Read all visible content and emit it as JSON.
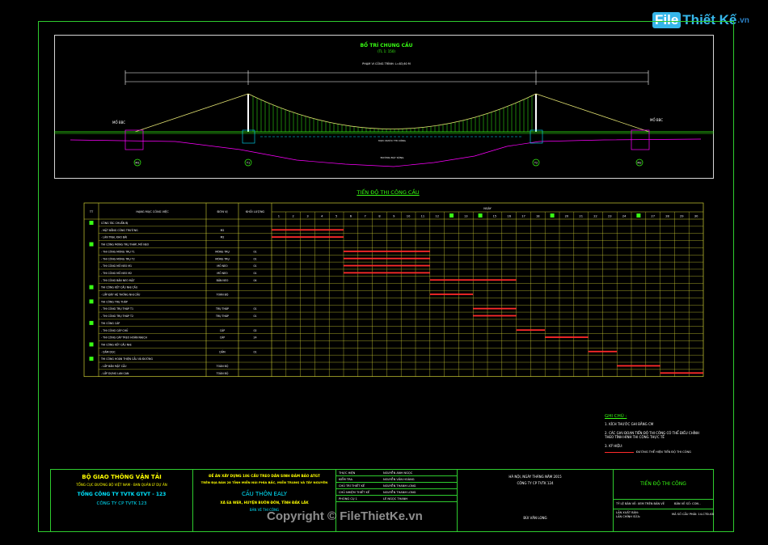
{
  "watermark": {
    "brand": "File",
    "brand2": "Thiết Kế",
    "suffix": ".vn",
    "copyright": "Copyright © FileThietKe.vn"
  },
  "drawing": {
    "title": "BỐ TRÍ CHUNG CẦU",
    "scale": "(TL 1: 150)",
    "length_note": "PHẠM VI CÔNG TRÌNH: L=83,60 M",
    "labels": {
      "mo_left": "MỐ BBC",
      "mo_right": "MỐ BBC",
      "water": "MỰC NƯỚC THI CÔNG",
      "bed": "ĐƯỜNG ĐÁY SÔNG"
    },
    "supports": [
      "M1",
      "T1",
      "T2",
      "M2"
    ]
  },
  "schedule": {
    "title": "TIẾN ĐỘ THI CÔNG CẦU",
    "headers": {
      "tt": "TT",
      "work": "HẠNG MỤC CÔNG VIỆC",
      "unit": "ĐƠN VỊ",
      "qty": "KHỐI LƯỢNG",
      "days": "NGÀY"
    },
    "day_labels": [
      "1",
      "2",
      "3",
      "4",
      "5",
      "6",
      "7",
      "8",
      "9",
      "10",
      "11",
      "12",
      "",
      "13",
      "",
      "15",
      "16",
      "17",
      "18",
      "",
      "20",
      "21",
      "22",
      "23",
      "24",
      "",
      "27",
      "28",
      "29",
      "30"
    ],
    "rows": [
      {
        "group": true,
        "name": "CÔNG TÁC CHUẨN BỊ",
        "unit": "",
        "qty": "",
        "bar": null
      },
      {
        "group": false,
        "name": "- MẶT BẰNG CÔNG TRƯỜNG",
        "unit": "M2",
        "qty": "",
        "bar": [
          1,
          5
        ]
      },
      {
        "group": false,
        "name": "- LÁN TRẠI, KHO BÃI",
        "unit": "M2",
        "qty": "",
        "bar": [
          1,
          5
        ]
      },
      {
        "group": true,
        "name": "THI CÔNG MÓNG TRỤ THÁP, MỐ NEO",
        "unit": "",
        "qty": "",
        "bar": null
      },
      {
        "group": false,
        "name": "- THI CÔNG MÓNG TRỤ T1",
        "unit": "MÓNG TRỤ",
        "qty": "01",
        "bar": [
          6,
          11
        ]
      },
      {
        "group": false,
        "name": "- THI CÔNG MÓNG TRỤ T2",
        "unit": "MÓNG TRỤ",
        "qty": "01",
        "bar": [
          6,
          11
        ]
      },
      {
        "group": false,
        "name": "- THI CÔNG MỐ NEO M1",
        "unit": "MỐ NEO",
        "qty": "01",
        "bar": [
          6,
          11
        ]
      },
      {
        "group": false,
        "name": "- THI CÔNG MỐ NEO M2",
        "unit": "MỐ NEO",
        "qty": "01",
        "bar": [
          6,
          11
        ]
      },
      {
        "group": false,
        "name": "- THI CÔNG BẢN NEO MẶT",
        "unit": "BẢN NEO",
        "qty": "04",
        "bar": [
          12,
          17
        ]
      },
      {
        "group": true,
        "name": "THI CÔNG KẾT CẤU NHỊ CẦU",
        "unit": "",
        "qty": "",
        "bar": null
      },
      {
        "group": false,
        "name": "- LẮP ĐẶT HỆ THỐNG NHỊ CẦU",
        "unit": "TOÀN BỘ",
        "qty": "",
        "bar": [
          12,
          14
        ]
      },
      {
        "group": true,
        "name": "THI CÔNG TRỤ THÁP",
        "unit": "",
        "qty": "",
        "bar": null
      },
      {
        "group": false,
        "name": "- THI CÔNG TRỤ THÁP T1",
        "unit": "TRỤ THÁP",
        "qty": "01",
        "bar": [
          15,
          17
        ]
      },
      {
        "group": false,
        "name": "- THI CÔNG TRỤ THÁP T2",
        "unit": "TRỤ THÁP",
        "qty": "01",
        "bar": [
          15,
          17
        ]
      },
      {
        "group": true,
        "name": "THI CÔNG CÁP",
        "unit": "",
        "qty": "",
        "bar": null
      },
      {
        "group": false,
        "name": "- THI CÔNG CÁP CHỦ",
        "unit": "CÁP",
        "qty": "02",
        "bar": [
          18,
          19
        ]
      },
      {
        "group": false,
        "name": "- THI CÔNG CÁP TREO HOÀN NHỊCH",
        "unit": "CÁP",
        "qty": "24",
        "bar": [
          20,
          22
        ]
      },
      {
        "group": true,
        "name": "THI CÔNG KẾT CẤU NHỊ",
        "unit": "",
        "qty": "",
        "bar": null
      },
      {
        "group": false,
        "name": "- DẦM DỌC",
        "unit": "DẦM",
        "qty": "01",
        "bar": [
          23,
          24
        ]
      },
      {
        "group": true,
        "name": "THI CÔNG HOÀN THIỆN CẦU VÀ ĐƯỜNG",
        "unit": "",
        "qty": "",
        "bar": null
      },
      {
        "group": false,
        "name": "- LẮP BẢN MẶT CẦU",
        "unit": "TOÀN BỘ",
        "qty": "",
        "bar": [
          25,
          27
        ]
      },
      {
        "group": false,
        "name": "- LẮP DỰNG LAN CAN",
        "unit": "TOÀN BỘ",
        "qty": "",
        "bar": [
          28,
          30
        ]
      }
    ]
  },
  "notes": {
    "title": "GHI CHÚ :",
    "items": [
      "1. KÍCH THƯỚC GHI BẰNG CM",
      "2. CÁC GIAI ĐOẠN TIẾN ĐỘ THI CÔNG CÓ THỂ ĐIỀU CHỈNH",
      "   THEO TÌNH HÌNH THI CÔNG THỰC TẾ",
      "3. KÝ HIỆU:"
    ],
    "legend": "ĐƯỜNG THỂ HIỆN TIẾN ĐỘ THI CÔNG"
  },
  "title_block": {
    "ministry": "BỘ GIAO THÔNG VẬN TẢI",
    "dept": "TỔNG CỤC ĐƯỜNG BỘ VIỆT NAM - BAN QUẢN LÝ DỰ ÁN",
    "corp": "TỔNG CÔNG TY TVTK GTVT - 123",
    "company": "CÔNG TY CP TVTK 123",
    "project_1": "ĐỀ ÁN XÂY DỰNG 186 CẦU TREO DÂN SINH ĐẢM BẢO ATGT",
    "project_2": "TRÊN ĐỊA BÀN 28 TỈNH MIỀN NÚI PHÍA BẮC, MIỀN TRUNG VÀ TÂY NGUYÊN",
    "bridge_name": "CẦU THÔN EALY",
    "location": "XÃ EA WER, HUYỆN BUÔN ĐÔN, TỈNH ĐẮK LẮK",
    "stage": "BẢN VẼ THI CÔNG",
    "roles": [
      {
        "role": "THỰC HIỆN",
        "name": "NGUYỄN ANH NGỌC"
      },
      {
        "role": "KIỂM TRA",
        "name": "NGUYỄN VĂN HOÀNG"
      },
      {
        "role": "CHỦ TRÌ THIẾT KẾ",
        "name": "NGUYỄN THANH LONG"
      },
      {
        "role": "CHỦ NHIỆM THIẾT KẾ",
        "name": "NGUYỄN THANH LONG"
      },
      {
        "role": "PHÒNG CỤ 1",
        "name": "LÊ NGỌC THANH"
      }
    ],
    "date": "HÀ NỘI, NGÀY      THÁNG     NĂM 2015",
    "sign_company": "CÔNG TY CP TVTK 124",
    "signer": "BÙI VĂN LONG",
    "sheet_title": "TIẾN ĐỘ THI CÔNG",
    "meta_1": "TỶ LỆ BẢN VẼ: XEM TRÊN BẢN VẼ",
    "meta_2": "BẢN VẼ SỐ: CON -",
    "meta_3": "LẦN XUẤT BẢN:",
    "meta_4": "LẦN CHỈNH SỬA:",
    "meta_5": "MÃ SỐ CẦU PHẢI: 14-CTĐ-KB"
  },
  "colors": {
    "frame": "#2ecc2e",
    "bar": "#ff2a2a",
    "cable": "#e0e070",
    "deck": "#39ff14",
    "tower": "#ffffff",
    "grid": "#cccc33"
  }
}
